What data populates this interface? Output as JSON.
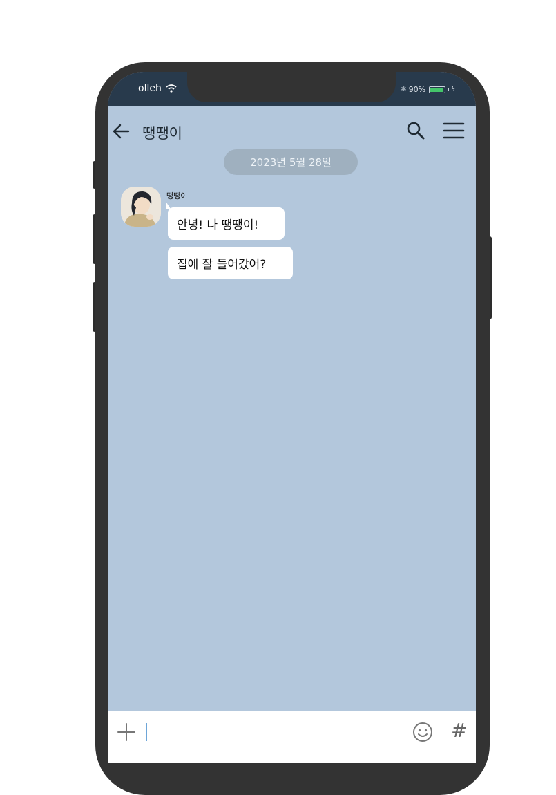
{
  "status_bar": {
    "carrier": "olleh",
    "battery_text": "90%",
    "battery_level": 0.9
  },
  "header": {
    "title": "땡땡이"
  },
  "chat": {
    "date_divider": "2023년 5월 28일",
    "sender_name": "땡땡이",
    "messages": [
      {
        "text": "안녕! 나 땡땡이!"
      },
      {
        "text": "집에 잘 들어갔어?"
      }
    ]
  },
  "icons": {
    "back": "arrow-left-icon",
    "search": "search-icon",
    "menu": "hamburger-menu-icon",
    "plus": "plus-icon",
    "emoji": "emoji-icon",
    "hashtag": "hash-icon"
  },
  "input_bar": {
    "hash_label": "#"
  },
  "colors": {
    "chat_background": "#b3c7dc",
    "status_bar": "#283a4c",
    "bubble": "#ffffff",
    "date_pill": "#9fb0bf"
  }
}
